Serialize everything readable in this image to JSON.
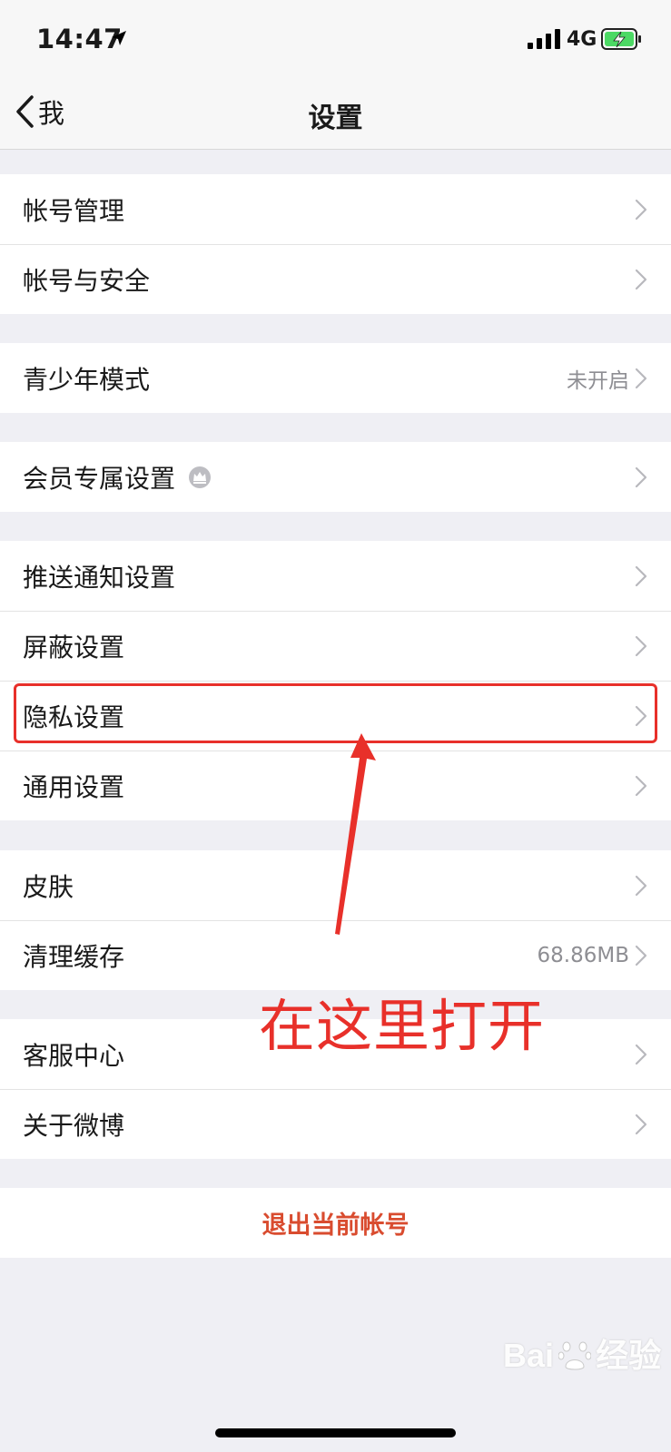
{
  "status_bar": {
    "time": "14:47",
    "network": "4G"
  },
  "nav": {
    "back_label": "我",
    "title": "设置"
  },
  "groups": [
    {
      "items": [
        {
          "label": "帐号管理"
        },
        {
          "label": "帐号与安全"
        }
      ]
    },
    {
      "items": [
        {
          "label": "青少年模式",
          "value": "未开启"
        }
      ]
    },
    {
      "items": [
        {
          "label": "会员专属设置",
          "icon": "crown-icon"
        }
      ]
    },
    {
      "items": [
        {
          "label": "推送通知设置"
        },
        {
          "label": "屏蔽设置"
        },
        {
          "label": "隐私设置"
        },
        {
          "label": "通用设置"
        }
      ]
    },
    {
      "items": [
        {
          "label": "皮肤"
        },
        {
          "label": "清理缓存",
          "value": "68.86MB"
        }
      ]
    },
    {
      "items": [
        {
          "label": "客服中心"
        },
        {
          "label": "关于微博"
        }
      ]
    }
  ],
  "logout_label": "退出当前帐号",
  "annotation": {
    "text": "在这里打开",
    "color": "#e8302a"
  },
  "watermark": {
    "brand": "Bai",
    "suffix": "经验"
  },
  "colors": {
    "accent_red": "#d94c2f",
    "background": "#efeff4",
    "secondary_text": "#8e8e93"
  }
}
